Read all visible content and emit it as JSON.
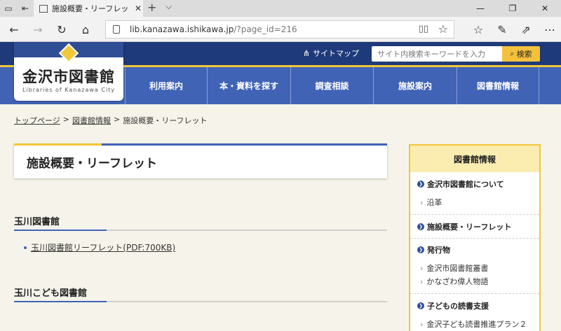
{
  "browser": {
    "tab_title": "施設概要・リーフレット - 金",
    "address_host": "lib.kanazawa.ishikawa.jp",
    "address_path": "/?page_id=216"
  },
  "site": {
    "logo_name": "金沢市図書館",
    "logo_sub": "Libraries of Kanazawa City",
    "sitemap": "サイトマップ",
    "search_placeholder": "サイト内検索キーワードを入力",
    "search_button": "検索",
    "menu": [
      "利用案内",
      "本・資料を探す",
      "調査相談",
      "施設案内",
      "図書館情報"
    ]
  },
  "breadcrumb": {
    "home": "トップページ",
    "sep": ">",
    "parent": "図書館情報",
    "current": "施設概要・リーフレット"
  },
  "page": {
    "title": "施設概要・リーフレット",
    "section1": "玉川図書館",
    "link1": "玉川図書館リーフレット(PDF:700KB)",
    "section2": "玉川こども図書館"
  },
  "side": {
    "heading": "図書館情報",
    "sections": [
      {
        "label": "金沢市図書館について",
        "items": [
          "沿革"
        ]
      },
      {
        "label": "施設概要・リーフレット",
        "items": []
      },
      {
        "label": "発行物",
        "items": [
          "金沢市図書館叢書",
          "かなざわ偉人物語"
        ]
      },
      {
        "label": "子どもの読書支援",
        "items": [
          "金沢子ども読書推進プラン２"
        ]
      }
    ]
  },
  "colors": {
    "navy": "#1f3a7a",
    "nav_blue": "#4063b6",
    "accent_yellow": "#f0c83a",
    "bg": "#f6f4ea"
  }
}
